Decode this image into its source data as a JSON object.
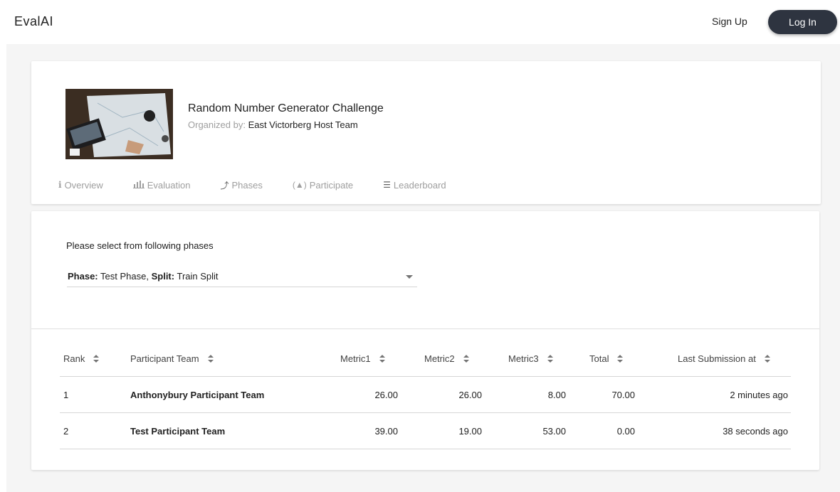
{
  "navbar": {
    "logo": "EvalAI",
    "signup_label": "Sign Up",
    "login_label": "Log In"
  },
  "challenge": {
    "title": "Random Number Generator Challenge",
    "organized_by_label": "Organized by:",
    "organizer": "East Victorberg Host Team"
  },
  "tabs": [
    {
      "label": "Overview",
      "icon": "info-icon"
    },
    {
      "label": "Evaluation",
      "icon": "bar-chart-icon"
    },
    {
      "label": "Phases",
      "icon": "phases-icon"
    },
    {
      "label": "Participate",
      "icon": "participate-icon"
    },
    {
      "label": "Leaderboard",
      "icon": "list-icon"
    }
  ],
  "leaderboard": {
    "select_prompt": "Please select from following phases",
    "phase_label": "Phase:",
    "phase_value": "Test Phase,",
    "split_label": "Split:",
    "split_value": "Train Split",
    "columns": [
      "Rank",
      "Participant Team",
      "Metric1",
      "Metric2",
      "Metric3",
      "Total",
      "Last Submission at"
    ],
    "rows": [
      {
        "rank": "1",
        "team": "Anthonybury Participant Team",
        "metric1": "26.00",
        "metric2": "26.00",
        "metric3": "8.00",
        "total": "70.00",
        "last": "2 minutes ago"
      },
      {
        "rank": "2",
        "team": "Test Participant Team",
        "metric1": "39.00",
        "metric2": "19.00",
        "metric3": "53.00",
        "total": "0.00",
        "last": "38 seconds ago"
      }
    ]
  },
  "colors": {
    "login_bg": "#2e3440",
    "page_bg": "#f5f5f5",
    "muted_text": "#9e9e9e"
  }
}
